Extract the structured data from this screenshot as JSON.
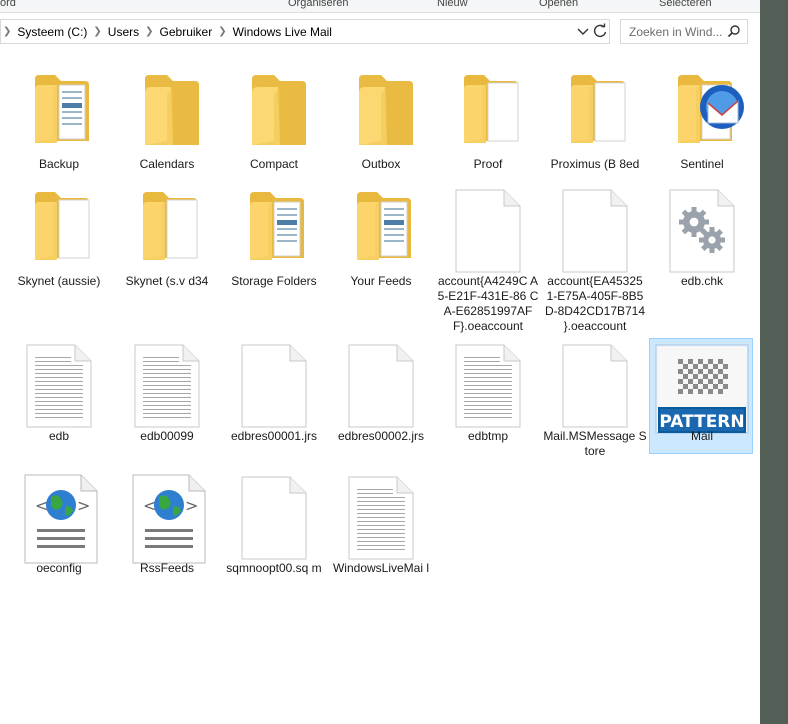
{
  "ribbon": {
    "items": [
      "ord",
      "Organiseren",
      "Nieuw",
      "Openen",
      "Selecteren"
    ]
  },
  "address": {
    "crumbs": [
      "Systeem (C:)",
      "Users",
      "Gebruiker",
      "Windows Live Mail"
    ]
  },
  "search": {
    "placeholder": "Zoeken in Wind..."
  },
  "files": [
    {
      "name": "Backup",
      "type": "folder-docs"
    },
    {
      "name": "Calendars",
      "type": "folder"
    },
    {
      "name": "Compact",
      "type": "folder"
    },
    {
      "name": "Outbox",
      "type": "folder"
    },
    {
      "name": "Proof",
      "type": "folder-paper"
    },
    {
      "name": "Proximus (B 8ed",
      "type": "folder-paper"
    },
    {
      "name": "Sentinel",
      "type": "folder-thunderbird"
    },
    {
      "name": "Skynet (aussie)",
      "type": "folder-paper"
    },
    {
      "name": "Skynet (s.v d34",
      "type": "folder-paper"
    },
    {
      "name": "Storage Folders",
      "type": "folder-docs"
    },
    {
      "name": "Your Feeds",
      "type": "folder-docs"
    },
    {
      "name": "account{A4249C A5-E21F-431E-86 CA-E62851997AF F}.oeaccount",
      "type": "blank"
    },
    {
      "name": "account{EA45325 1-E75A-405F-8B5 D-8D42CD17B714 }.oeaccount",
      "type": "blank"
    },
    {
      "name": "edb.chk",
      "type": "gears"
    },
    {
      "name": "edb",
      "type": "lined"
    },
    {
      "name": "edb00099",
      "type": "lined"
    },
    {
      "name": "edbres00001.jrs",
      "type": "blank"
    },
    {
      "name": "edbres00002.jrs",
      "type": "blank"
    },
    {
      "name": "edbtmp",
      "type": "lined"
    },
    {
      "name": "Mail.MSMessage Store",
      "type": "blank"
    },
    {
      "name": "Mail",
      "type": "pattern",
      "selected": true,
      "badge": "PATTERN"
    },
    {
      "name": "oeconfig",
      "type": "globe-xml"
    },
    {
      "name": "RssFeeds",
      "type": "globe-xml"
    },
    {
      "name": "sqmnoopt00.sq m",
      "type": "blank"
    },
    {
      "name": "WindowsLiveMai l",
      "type": "lined"
    }
  ]
}
